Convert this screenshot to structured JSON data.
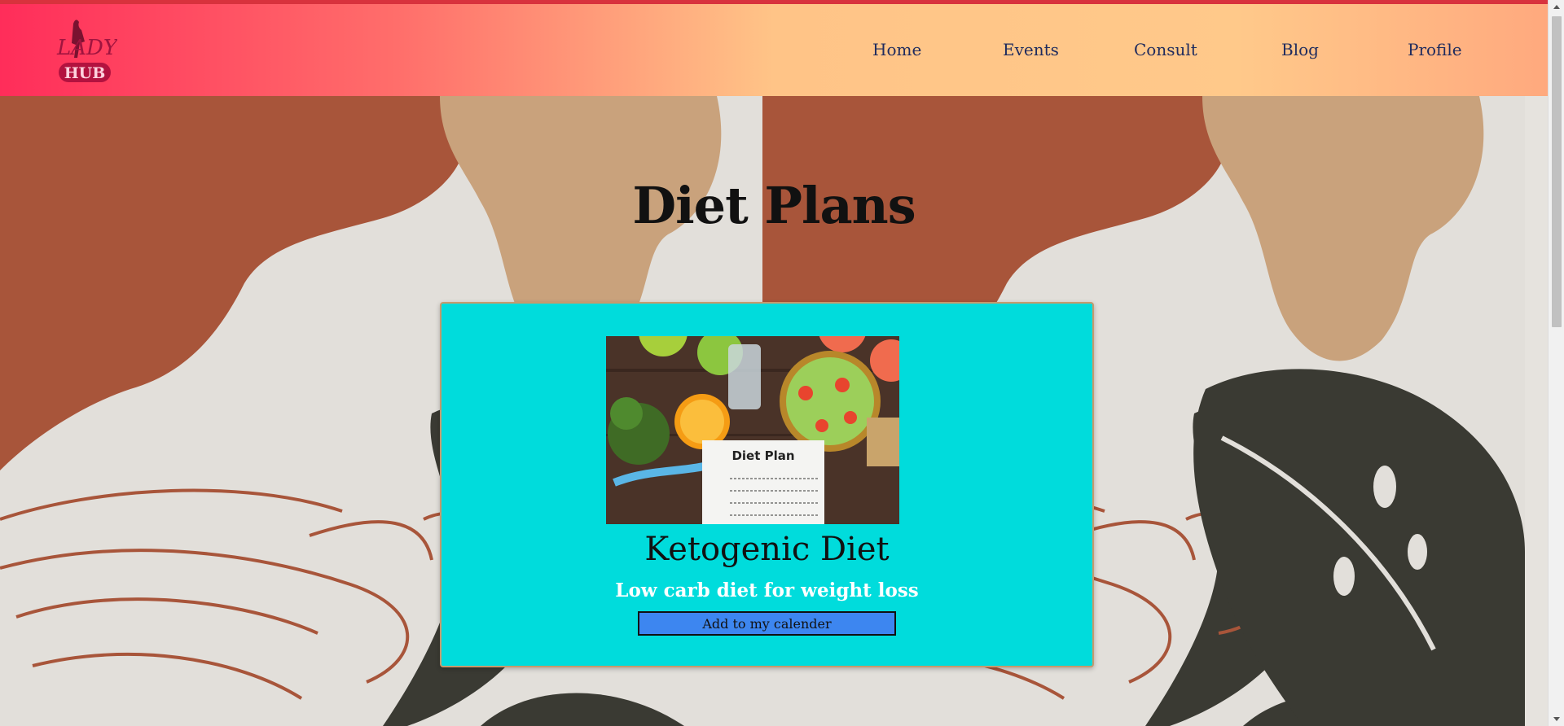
{
  "header": {
    "logo": {
      "top_text": "LADY",
      "bottom_text": "HUB"
    },
    "nav": [
      {
        "label": "Home"
      },
      {
        "label": "Events"
      },
      {
        "label": "Consult"
      },
      {
        "label": "Blog"
      },
      {
        "label": "Profile"
      }
    ]
  },
  "main": {
    "title": "Diet Plans",
    "card": {
      "image_text": "Diet Plan",
      "title": "Ketogenic Diet",
      "subtitle": "Low carb diet for weight loss",
      "button_label": "Add to my calender"
    }
  },
  "colors": {
    "card_bg": "#00dcdc",
    "button_bg": "#3d86f0",
    "nav_text": "#1f2b5e"
  }
}
